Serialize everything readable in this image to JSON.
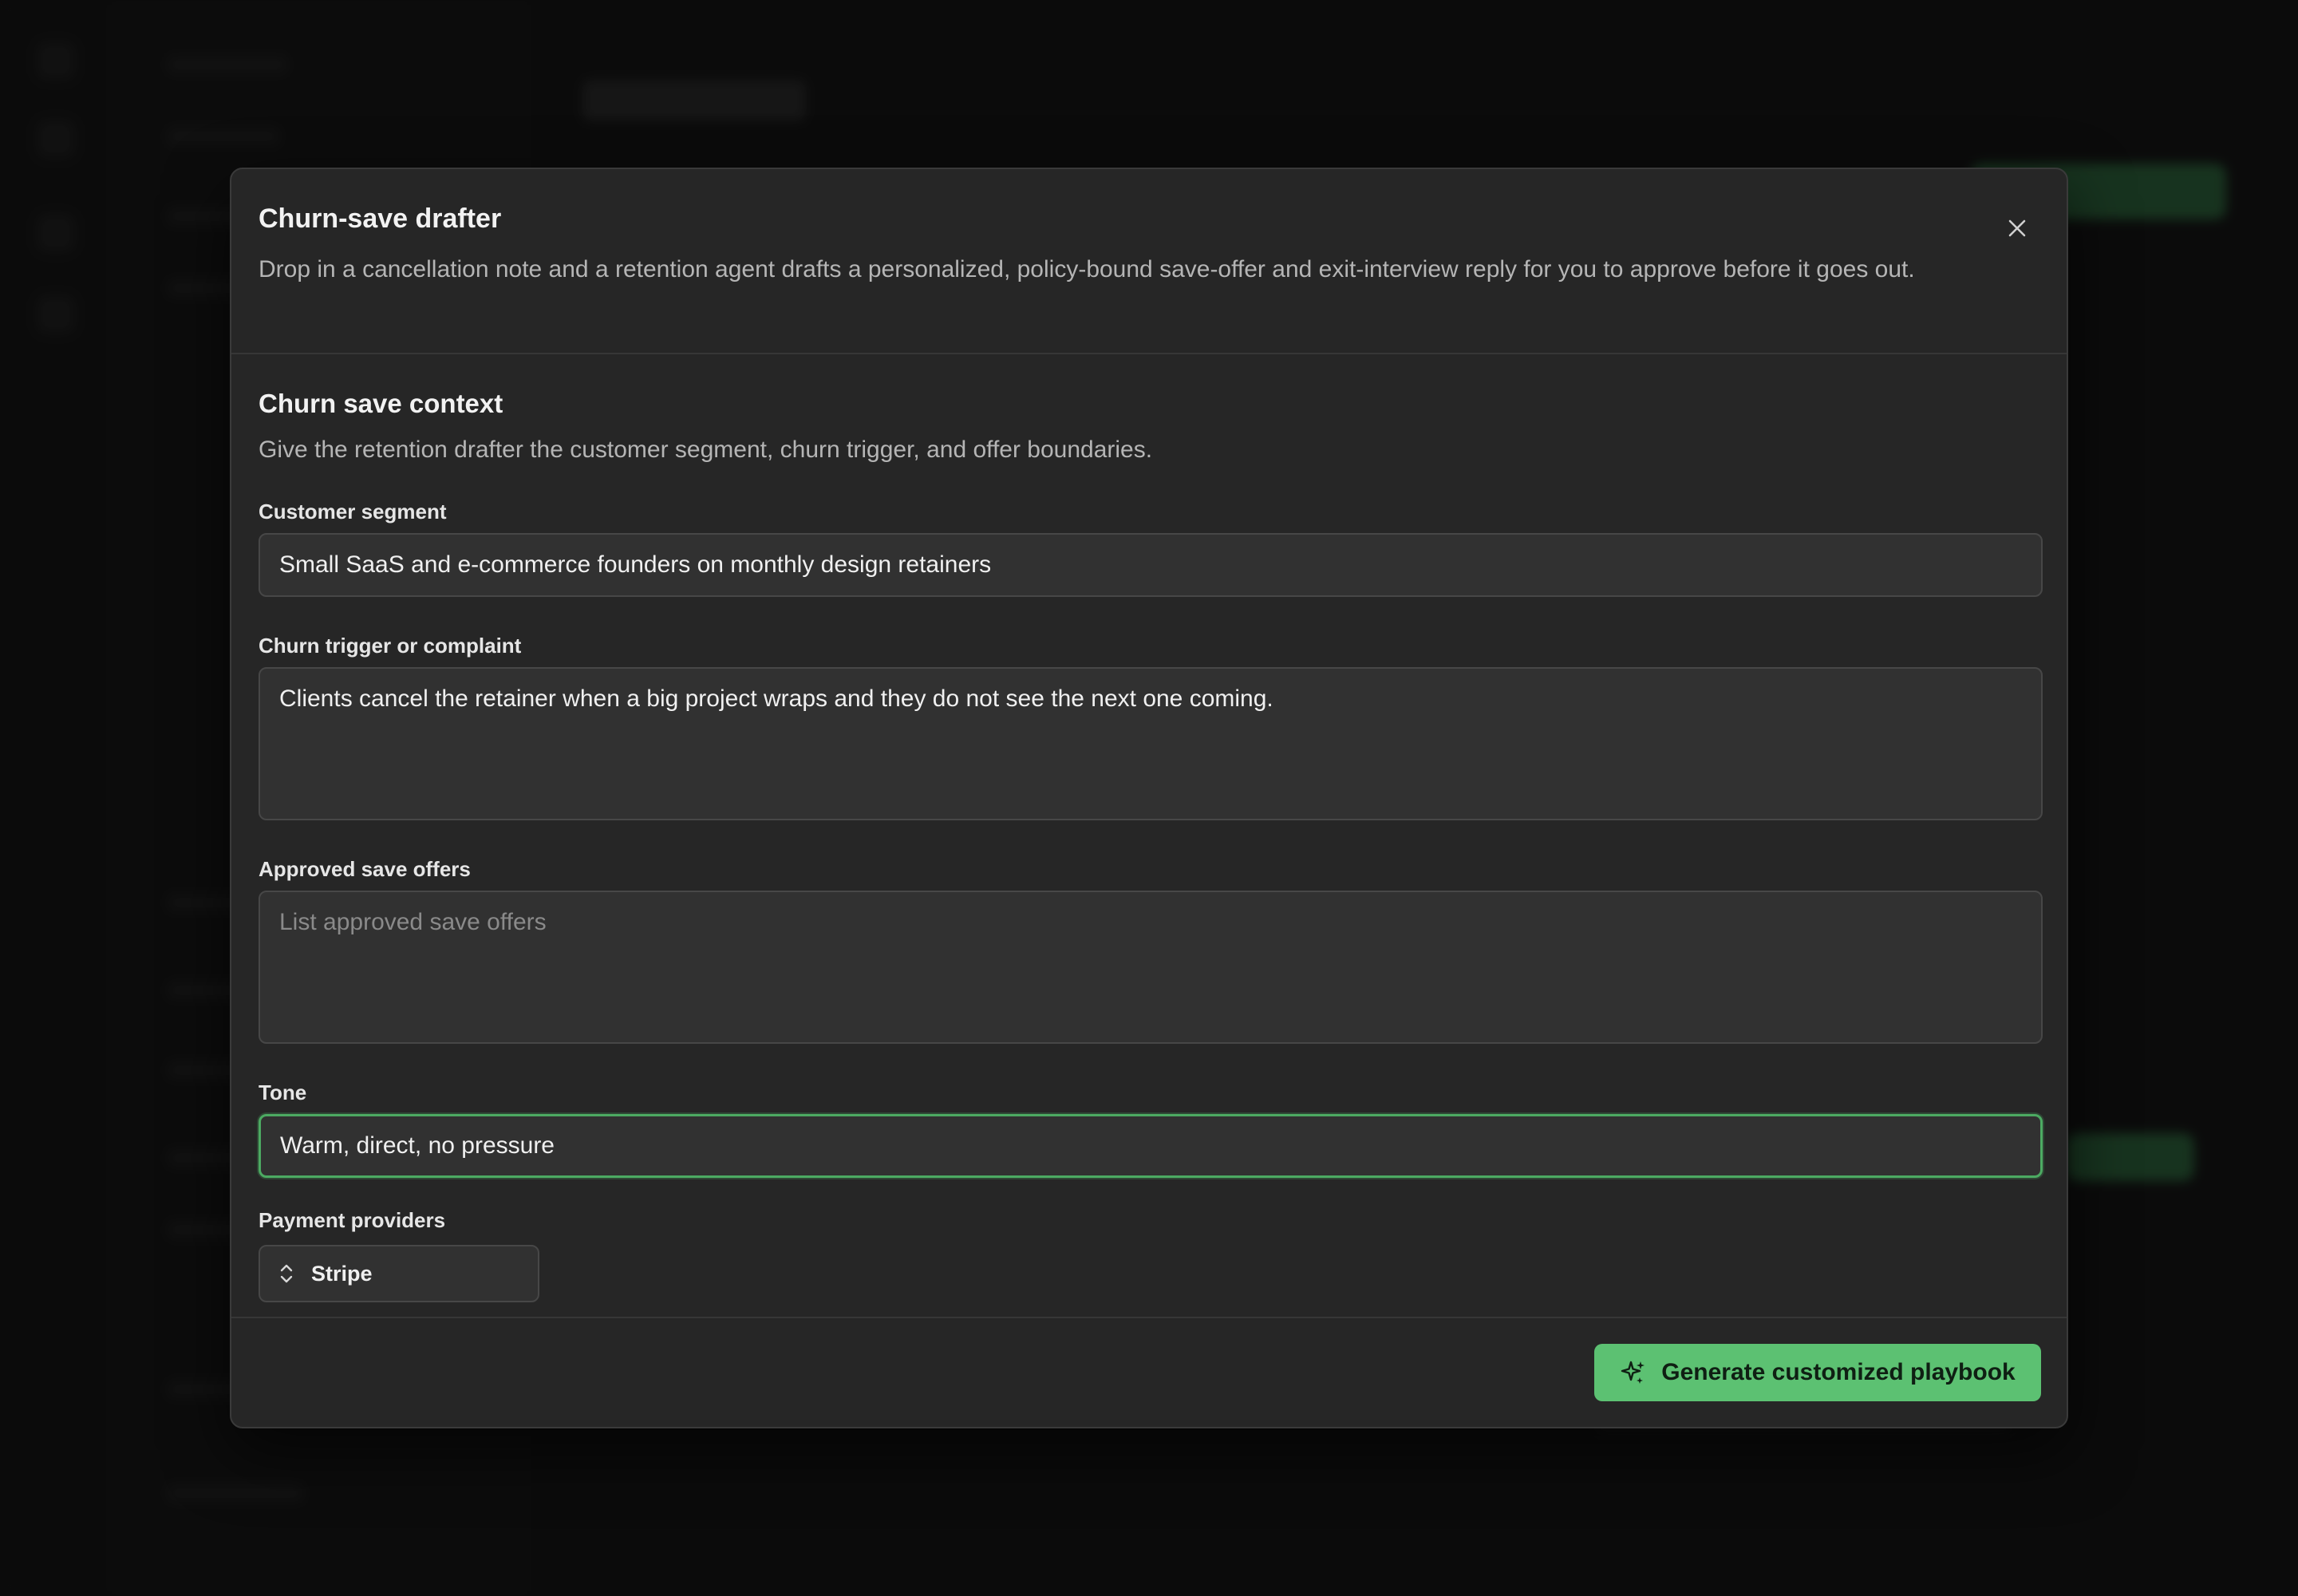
{
  "modal": {
    "title": "Churn-save drafter",
    "description": "Drop in a cancellation note and a retention agent drafts a personalized, policy-bound save-offer and exit-interview reply for you to approve before it goes out.",
    "close_icon": "close-icon"
  },
  "section": {
    "title": "Churn save context",
    "description": "Give the retention drafter the customer segment, churn trigger, and offer boundaries."
  },
  "fields": {
    "segment": {
      "label": "Customer segment",
      "value": "Small SaaS and e-commerce founders on monthly design retainers"
    },
    "trigger": {
      "label": "Churn trigger or complaint",
      "value": "Clients cancel the retainer when a big project wraps and they do not see the next one coming."
    },
    "offers": {
      "label": "Approved save offers",
      "value": "",
      "placeholder": "List approved save offers"
    },
    "tone": {
      "label": "Tone",
      "value": "Warm, direct, no pressure"
    },
    "providers": {
      "label": "Payment providers",
      "selected": "Stripe",
      "icon": "chevron-up-down-icon"
    }
  },
  "footer": {
    "generate_label": "Generate customized playbook",
    "generate_icon": "sparkles-icon"
  },
  "colors": {
    "accent": "#5cc172",
    "focus_border": "#4caa62",
    "modal_bg": "#262626"
  }
}
